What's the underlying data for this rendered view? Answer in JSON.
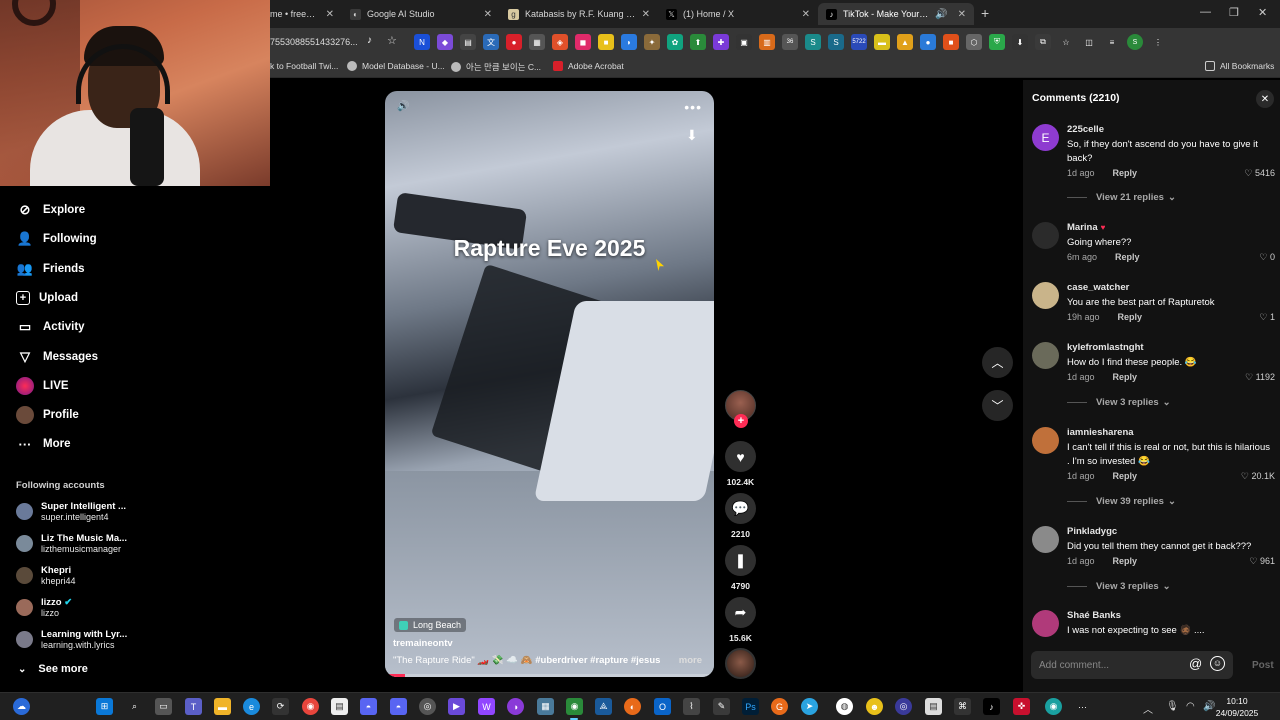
{
  "browser": {
    "tabs": [
      {
        "title": "me • freemedi",
        "favicon_color": "#555555"
      },
      {
        "title": "Google AI Studio",
        "favicon_color": "#3a3a3a"
      },
      {
        "title": "Katabasis by R.F. Kuang | Good",
        "favicon_color": "#d8c9a0"
      },
      {
        "title": "(1) Home / X",
        "favicon_color": "#000000"
      },
      {
        "title": "TikTok - Make Your Day",
        "favicon_color": "#000000"
      }
    ],
    "new_tab": "+",
    "address": "7553088551433276...",
    "bookmarks": [
      {
        "label": "k to Football Twi..."
      },
      {
        "label": "Model Database - U..."
      },
      {
        "label": "아는 만큼 보이는 C..."
      },
      {
        "label": "Adobe Acrobat"
      }
    ],
    "all_bookmarks": "All Bookmarks",
    "ext_badges": {
      "badge1": "36",
      "badge2": "5722"
    }
  },
  "sidebar": {
    "nav": [
      {
        "label": "Explore",
        "icon": "compass-icon"
      },
      {
        "label": "Following",
        "icon": "following-icon"
      },
      {
        "label": "Friends",
        "icon": "friends-icon"
      },
      {
        "label": "Upload",
        "icon": "upload-icon"
      },
      {
        "label": "Activity",
        "icon": "activity-icon"
      },
      {
        "label": "Messages",
        "icon": "messages-icon"
      },
      {
        "label": "LIVE",
        "icon": "live-icon"
      },
      {
        "label": "Profile",
        "icon": "profile-icon"
      },
      {
        "label": "More",
        "icon": "more-icon"
      }
    ],
    "following_header": "Following accounts",
    "accounts": [
      {
        "name": "Super Intelligent ...",
        "handle": "super.intelligent4"
      },
      {
        "name": "Liz The Music Ma...",
        "handle": "lizthemusicmanager"
      },
      {
        "name": "Khepri",
        "handle": "khepri44"
      },
      {
        "name": "lizzo",
        "handle": "lizzo"
      },
      {
        "name": "Learning with Lyr...",
        "handle": "learning.with.lyrics"
      }
    ],
    "see_more": "See more"
  },
  "video": {
    "overlay_title": "Rapture Eve 2025",
    "location": "Long Beach",
    "username": "tremaineontv",
    "caption": "\"The Rapture Ride\" 🏎️ 💸 ☁️ 🙈",
    "tags": [
      "#uberdriver",
      "#rapture",
      "#jesus"
    ],
    "more": "more",
    "progress": 0.06
  },
  "actions": {
    "likes": "102.4K",
    "comments": "2210",
    "saves": "4790",
    "shares": "15.6K"
  },
  "comments": {
    "header": "Comments (2210)",
    "items": [
      {
        "user": "225celle",
        "avatar_letter": "E",
        "avatar_color": "#8e3bd0",
        "text": "So, if they don't ascend do you have to give it back?",
        "time": "1d ago",
        "reply": "Reply",
        "likes": "5416",
        "view_replies": "View 21 replies"
      },
      {
        "user": "Marina",
        "avatar_letter": "",
        "avatar_color": "#2b2b2b",
        "text": "Going where??",
        "time": "6m ago",
        "reply": "Reply",
        "likes": "0",
        "view_replies": ""
      },
      {
        "user": "case_watcher",
        "avatar_letter": "",
        "avatar_color": "#c9b48a",
        "text": "You are the best part of Rapturetok",
        "time": "19h ago",
        "reply": "Reply",
        "likes": "1",
        "view_replies": ""
      },
      {
        "user": "kylefromlastnght",
        "avatar_letter": "",
        "avatar_color": "#6a6a5a",
        "text": "How do I find these people. 😂",
        "time": "1d ago",
        "reply": "Reply",
        "likes": "1192",
        "view_replies": "View 3 replies"
      },
      {
        "user": "iamniesharena",
        "avatar_letter": "",
        "avatar_color": "#c0703a",
        "text": "I can't tell if this is real or not, but this is hilarious . I'm so invested 😂",
        "time": "1d ago",
        "reply": "Reply",
        "likes": "20.1K",
        "view_replies": "View 39 replies"
      },
      {
        "user": "Pinkladygc",
        "avatar_letter": "",
        "avatar_color": "#8a8a8a",
        "text": "Did you tell them they cannot get it back???",
        "time": "1d ago",
        "reply": "Reply",
        "likes": "961",
        "view_replies": "View 3 replies"
      },
      {
        "user": "Shaé Banks",
        "avatar_letter": "",
        "avatar_color": "#b03a7a",
        "text": "I was not expecting to see 🧔🏾 ....",
        "time": "",
        "reply": "",
        "likes": "",
        "view_replies": ""
      }
    ],
    "input_placeholder": "Add comment...",
    "at_symbol": "@",
    "post": "Post"
  },
  "taskbar": {
    "time": "10:10",
    "date": "24/09/2025"
  },
  "colors": {
    "accent": "#fe2c55",
    "panel": "#121212",
    "taskbar": "#202020"
  }
}
